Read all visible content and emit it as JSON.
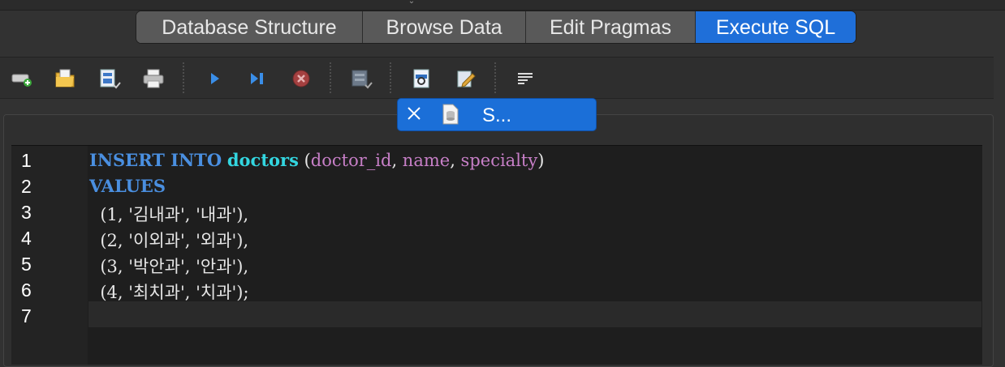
{
  "tabs": [
    {
      "label": "Database Structure",
      "active": false
    },
    {
      "label": "Browse Data",
      "active": false
    },
    {
      "label": "Edit Pragmas",
      "active": false
    },
    {
      "label": "Execute SQL",
      "active": true
    }
  ],
  "toolbar": {
    "buttons": [
      {
        "name": "open-tab-icon"
      },
      {
        "name": "open-sql-file-icon"
      },
      {
        "name": "save-sql-file-icon"
      },
      {
        "name": "print-icon"
      },
      {
        "name": "execute-all-icon"
      },
      {
        "name": "execute-current-line-icon"
      },
      {
        "name": "stop-execution-icon"
      },
      {
        "name": "save-results-icon"
      },
      {
        "name": "find-icon"
      },
      {
        "name": "find-replace-icon"
      },
      {
        "name": "comment-lines-icon"
      }
    ]
  },
  "file_tab": {
    "name": "S...",
    "close_icon": "close-icon",
    "doc_icon": "sql-document-icon"
  },
  "editor": {
    "line_numbers": [
      "1",
      "2",
      "3",
      "4",
      "5",
      "6",
      "7"
    ],
    "lines": [
      {
        "kw1": "INSERT INTO",
        "table": "doctors",
        "open": " (",
        "c1": "doctor_id",
        "s1": ", ",
        "c2": "name",
        "s2": ", ",
        "c3": "specialty",
        "close": ")"
      },
      {
        "kw": "VALUES"
      },
      {
        "text": "  (1, '김내과', '내과'),"
      },
      {
        "text": "  (2, '이외과', '외과'),"
      },
      {
        "text": "  (3, '박안과', '안과'),"
      },
      {
        "text": "  (4, '최치과', '치과');"
      },
      {
        "text": ""
      }
    ]
  },
  "colors": {
    "accent": "#1f6fd9",
    "keyword": "#4a8fe0",
    "table": "#33d6e0",
    "column": "#c77fc7"
  }
}
